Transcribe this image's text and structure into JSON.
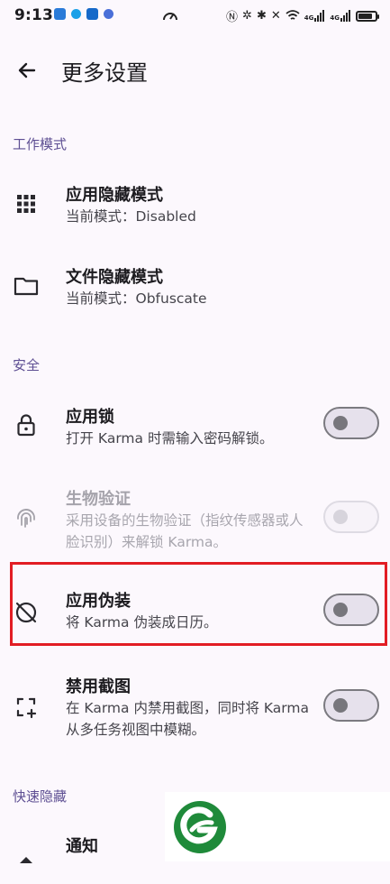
{
  "status": {
    "time": "9:13",
    "network_4g_label": "4G"
  },
  "appbar": {
    "title": "更多设置"
  },
  "sections": {
    "work_mode": "工作模式",
    "security": "安全",
    "quick_hide": "快速隐藏"
  },
  "items": {
    "app_hide": {
      "title": "应用隐藏模式",
      "subtitle": "当前模式：Disabled"
    },
    "file_hide": {
      "title": "文件隐藏模式",
      "subtitle": "当前模式：Obfuscate"
    },
    "app_lock": {
      "title": "应用锁",
      "subtitle": "打开 Karma 时需输入密码解锁。",
      "enabled": false
    },
    "biometric": {
      "title": "生物验证",
      "subtitle": "采用设备的生物验证（指纹传感器或人脸识别）来解锁 Karma。",
      "enabled": false,
      "disabled": true
    },
    "app_disguise": {
      "title": "应用伪装",
      "subtitle": "将 Karma 伪装成日历。",
      "enabled": false
    },
    "disable_screenshot": {
      "title": "禁用截图",
      "subtitle": "在 Karma 内禁用截图，同时将 Karma 从多任务视图中模糊。",
      "enabled": false
    },
    "notification": {
      "title": "通知"
    }
  },
  "colors": {
    "accent": "#5e4f93",
    "highlight": "#e21d24",
    "logo_green": "#1f8a3a"
  }
}
